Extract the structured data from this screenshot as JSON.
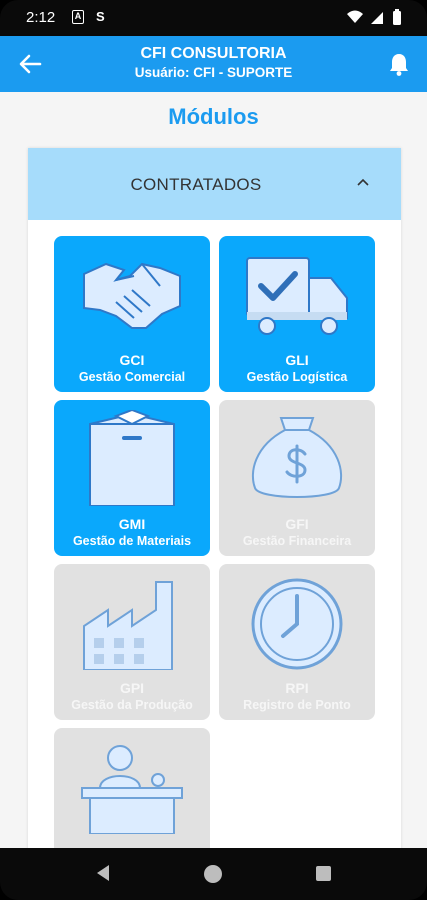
{
  "status_bar": {
    "time": "2:12",
    "icon_left_1": "A",
    "icon_left_2": "S"
  },
  "app_bar": {
    "title": "CFI CONSULTORIA",
    "subtitle": "Usuário: CFI - SUPORTE"
  },
  "page": {
    "title": "Módulos"
  },
  "section": {
    "title": "CONTRATADOS",
    "modules": [
      {
        "code": "GCI",
        "name": "Gestão Comercial",
        "state": "active",
        "icon": "handshake-icon"
      },
      {
        "code": "GLI",
        "name": "Gestão Logística",
        "state": "active",
        "icon": "truck-icon"
      },
      {
        "code": "GMI",
        "name": "Gestão de Materiais",
        "state": "active",
        "icon": "box-icon"
      },
      {
        "code": "GFI",
        "name": "Gestão Financeira",
        "state": "disabled",
        "icon": "money-bag-icon"
      },
      {
        "code": "GPI",
        "name": "Gestão da Produção",
        "state": "disabled",
        "icon": "factory-icon"
      },
      {
        "code": "RPI",
        "name": "Registro de Ponto",
        "state": "disabled",
        "icon": "clock-icon"
      },
      {
        "code": "",
        "name": "",
        "state": "disabled",
        "icon": "reception-desk-icon"
      }
    ]
  },
  "colors": {
    "primary": "#1b9bf0",
    "card_active": "#0aa8fc",
    "card_disabled": "#e1e1e1",
    "section_header": "#a6dcfb"
  }
}
